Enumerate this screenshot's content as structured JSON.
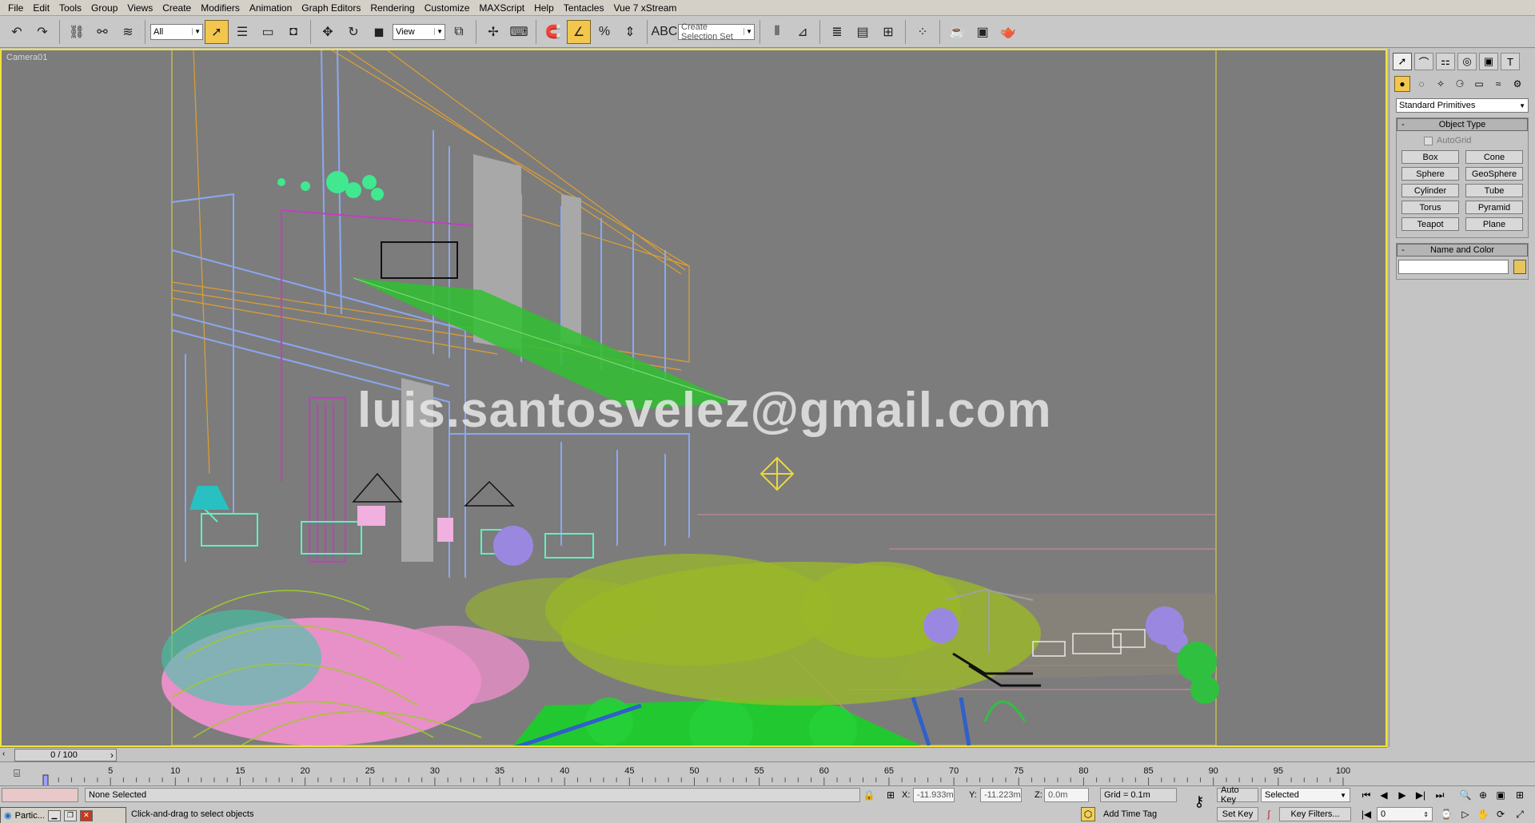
{
  "menu": [
    "File",
    "Edit",
    "Tools",
    "Group",
    "Views",
    "Create",
    "Modifiers",
    "Animation",
    "Graph Editors",
    "Rendering",
    "Customize",
    "MAXScript",
    "Help",
    "Tentacles",
    "Vue 7 xStream"
  ],
  "toolbar": {
    "filter_value": "All",
    "refcoord_value": "View",
    "selection_set_placeholder": "Create Selection Set"
  },
  "viewport": {
    "label": "Camera01",
    "watermark": "luis.santosvelez@gmail.com"
  },
  "command_panel": {
    "category": "Standard Primitives",
    "object_type_title": "Object Type",
    "autogrid_label": "AutoGrid",
    "primitives": [
      "Box",
      "Cone",
      "Sphere",
      "GeoSphere",
      "Cylinder",
      "Tube",
      "Torus",
      "Pyramid",
      "Teapot",
      "Plane"
    ],
    "name_color_title": "Name and Color",
    "swatch_color": "#e8c45c"
  },
  "timeline": {
    "frame_readout": "0 / 100",
    "ticks": [
      "5",
      "10",
      "15",
      "20",
      "25",
      "30",
      "35",
      "40",
      "45",
      "50",
      "55",
      "60",
      "65",
      "70",
      "75",
      "80",
      "85",
      "90",
      "95",
      "100"
    ]
  },
  "status": {
    "selection": "None Selected",
    "prompt": "Click-and-drag to select objects",
    "taskbar_item": "Partic...",
    "x_label": "X:",
    "x_value": "-11.933m",
    "y_label": "Y:",
    "y_value": "-11.223m",
    "z_label": "Z:",
    "z_value": "0.0m",
    "grid": "Grid = 0.1m",
    "add_time_tag": "Add Time Tag",
    "auto_key": "Auto Key",
    "set_key": "Set Key",
    "key_mode": "Selected",
    "key_filters": "Key Filters...",
    "current_frame": "0"
  },
  "colors": {
    "viewport_bg": "#7c7c7c",
    "viewport_border": "#f0e23c",
    "active_tool": "#f3c74d"
  }
}
